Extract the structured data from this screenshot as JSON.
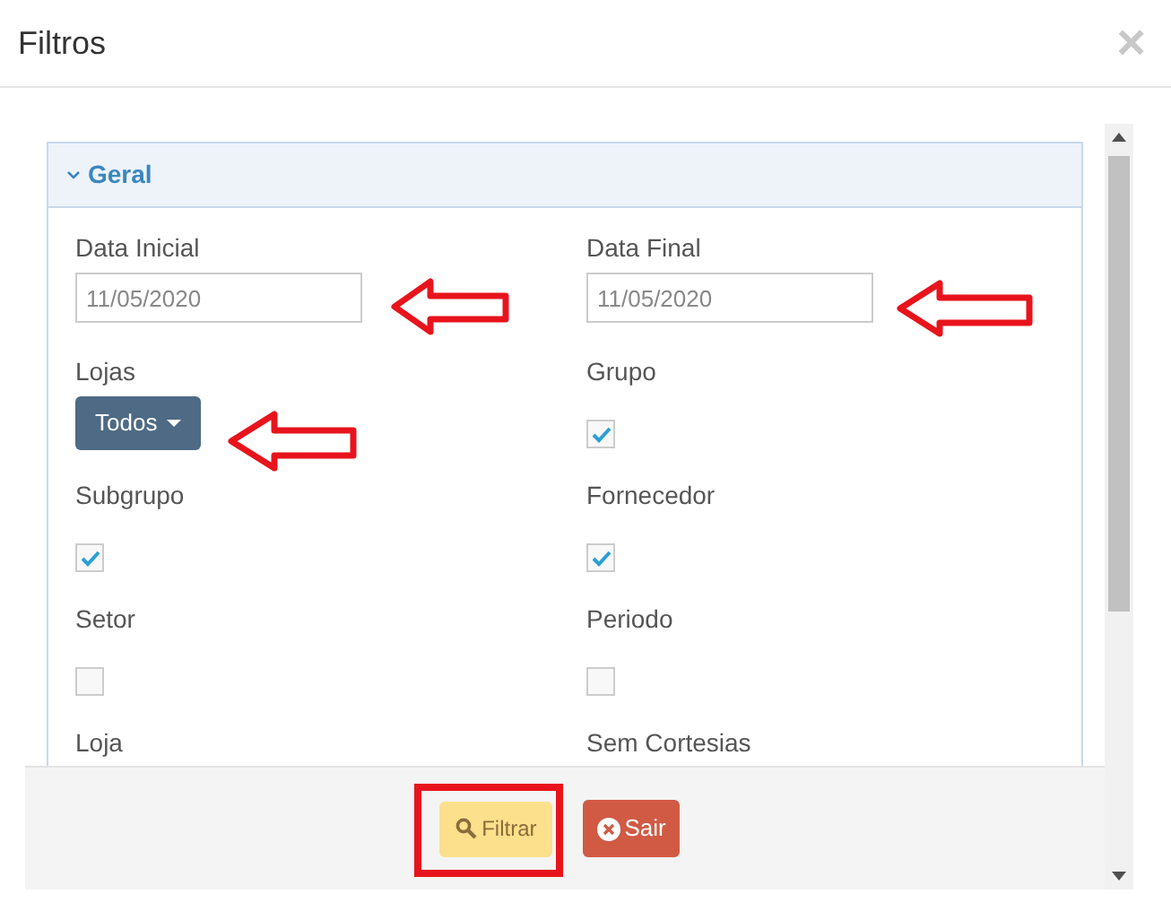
{
  "window": {
    "title": "Filtros",
    "close": "×"
  },
  "panel": {
    "title": "Geral",
    "expanded": true,
    "fields": [
      {
        "label": "Data Inicial",
        "kind": "date",
        "value": "11/05/2020"
      },
      {
        "label": "Data Final",
        "kind": "date",
        "value": "11/05/2020"
      },
      {
        "label": "Lojas",
        "kind": "dropdown",
        "value": "Todos"
      },
      {
        "label": "Grupo",
        "kind": "checkbox",
        "checked": true
      },
      {
        "label": "Subgrupo",
        "kind": "checkbox",
        "checked": true
      },
      {
        "label": "Fornecedor",
        "kind": "checkbox",
        "checked": true
      },
      {
        "label": "Setor",
        "kind": "checkbox",
        "checked": false
      },
      {
        "label": "Periodo",
        "kind": "checkbox",
        "checked": false
      },
      {
        "label": "Loja",
        "kind": "label_only"
      },
      {
        "label": "Sem Cortesias",
        "kind": "label_only"
      }
    ]
  },
  "buttons": [
    {
      "label": "Filtrar",
      "kind": "filter"
    },
    {
      "label": "Sair",
      "kind": "exit"
    }
  ]
}
